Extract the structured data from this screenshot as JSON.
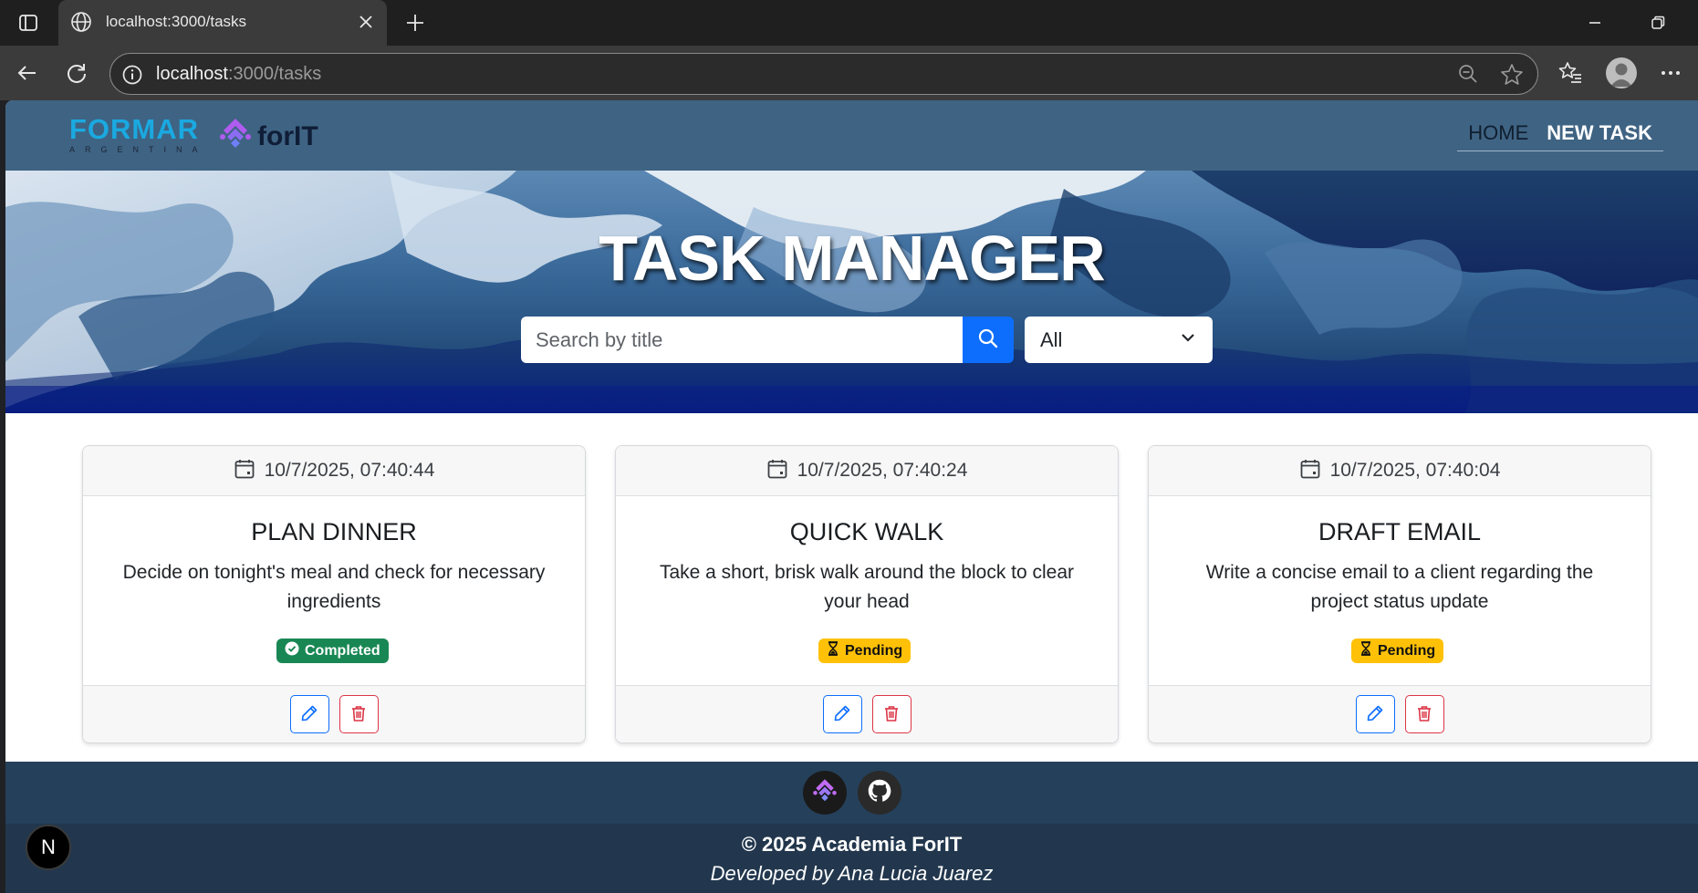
{
  "browser": {
    "tab_title": "localhost:3000/tasks",
    "url_host": "localhost",
    "url_path": ":3000/tasks"
  },
  "navbar": {
    "brand_formar": "FORMAR",
    "brand_formar_sub": "ARGENTINA",
    "brand_forit": "forIT",
    "links": [
      {
        "label": "HOME",
        "active": false
      },
      {
        "label": "NEW TASK",
        "active": true
      }
    ]
  },
  "hero": {
    "title": "TASK MANAGER",
    "search_placeholder": "Search by title",
    "filter_value": "All"
  },
  "tasks": [
    {
      "date": "10/7/2025, 07:40:44",
      "title": "PLAN DINNER",
      "description": "Decide on tonight's meal and check for necessary ingredients",
      "status": "Completed"
    },
    {
      "date": "10/7/2025, 07:40:24",
      "title": "QUICK WALK",
      "description": "Take a short, brisk walk around the block to clear your head",
      "status": "Pending"
    },
    {
      "date": "10/7/2025, 07:40:04",
      "title": "DRAFT EMAIL",
      "description": "Write a concise email to a client regarding the project status update",
      "status": "Pending"
    }
  ],
  "footer": {
    "copyright": "© 2025 Academia ForIT",
    "developed_by": "Developed by Ana Lucia Juarez"
  },
  "dev_indicator": "N",
  "colors": {
    "navbar": "#3f6383",
    "primary": "#0d6efd",
    "danger": "#dc3545",
    "success": "#198754",
    "warning": "#ffc107",
    "footer": "#22374d"
  },
  "icons": [
    "sidebar-icon",
    "globe-icon",
    "close-icon",
    "plus-icon",
    "minimize-icon",
    "restore-icon",
    "back-icon",
    "reload-icon",
    "info-icon",
    "zoom-out-icon",
    "star-icon",
    "favorites-icon",
    "profile-icon",
    "more-icon",
    "forit-icon",
    "search-icon",
    "chevron-down-icon",
    "calendar-icon",
    "check-circle-icon",
    "hourglass-icon",
    "pencil-icon",
    "trash-icon",
    "github-icon"
  ]
}
